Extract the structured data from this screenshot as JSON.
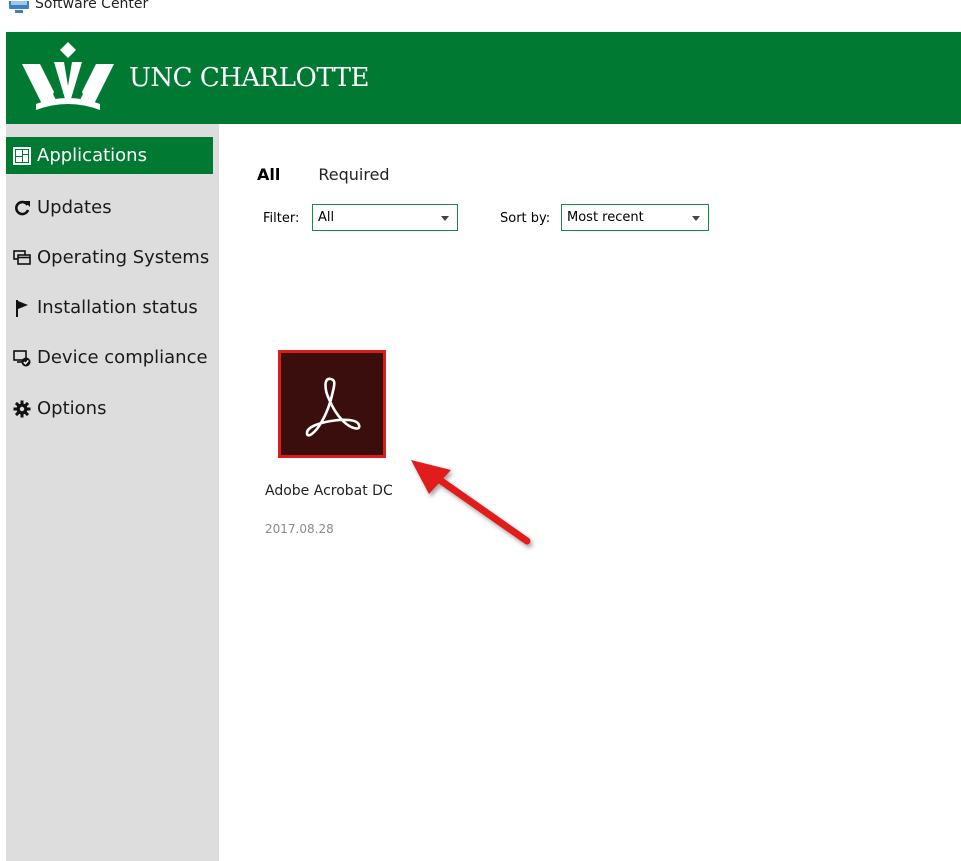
{
  "window": {
    "title": "Software Center"
  },
  "banner": {
    "brand": "UNC CHARLOTTE",
    "bg_color": "#007a33"
  },
  "sidebar": {
    "items": [
      {
        "label": "Applications",
        "icon": "applications-grid-icon",
        "active": true
      },
      {
        "label": "Updates",
        "icon": "refresh-icon",
        "active": false
      },
      {
        "label": "Operating Systems",
        "icon": "operating-systems-icon",
        "active": false
      },
      {
        "label": "Installation status",
        "icon": "flag-icon",
        "active": false
      },
      {
        "label": "Device compliance",
        "icon": "device-compliance-icon",
        "active": false
      },
      {
        "label": "Options",
        "icon": "gear-icon",
        "active": false
      }
    ]
  },
  "main": {
    "tabs": [
      {
        "label": "All",
        "selected": true
      },
      {
        "label": "Required",
        "selected": false
      }
    ],
    "filter": {
      "label": "Filter:",
      "value": "All"
    },
    "sort": {
      "label": "Sort by:",
      "value": "Most recent"
    },
    "apps": [
      {
        "name": "Adobe Acrobat DC",
        "date": "2017.08.28",
        "icon": "adobe-acrobat-icon"
      }
    ]
  },
  "colors": {
    "accent": "#007a33",
    "sidebar_bg": "#dddddd",
    "annotation_arrow": "#e11a1a"
  }
}
